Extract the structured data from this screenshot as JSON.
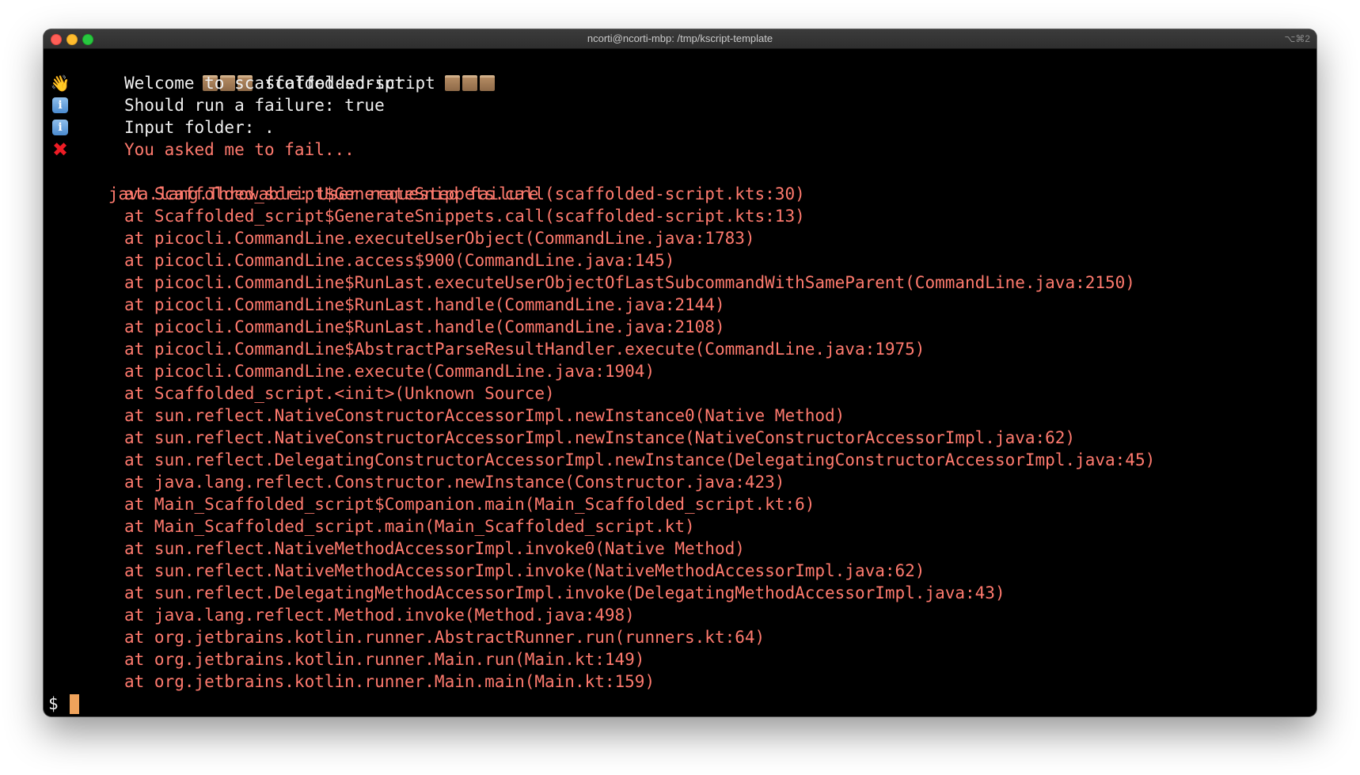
{
  "window": {
    "title": "ncorti@ncorti-mbp: /tmp/kscript-template",
    "shortcut": "⌥⌘2"
  },
  "header": {
    "text": "scaffolded-script"
  },
  "messages": [
    {
      "icon": "waving-hand-icon",
      "glyph": "👋",
      "text": "Welcome to scaffolded-script",
      "color": "white"
    },
    {
      "icon": "info-icon",
      "glyph": "i",
      "text": "Should run a failure: true",
      "color": "white"
    },
    {
      "icon": "info-icon",
      "glyph": "i",
      "text": "Input folder: .",
      "color": "white"
    },
    {
      "icon": "cross-mark-icon",
      "glyph": "✖",
      "text": "You asked me to fail...",
      "color": "red"
    }
  ],
  "exception": "java.lang.Throwable: User requested failure",
  "stack": [
    "at Scaffolded_script$GenerateSnippets.call(scaffolded-script.kts:30)",
    "at Scaffolded_script$GenerateSnippets.call(scaffolded-script.kts:13)",
    "at picocli.CommandLine.executeUserObject(CommandLine.java:1783)",
    "at picocli.CommandLine.access$900(CommandLine.java:145)",
    "at picocli.CommandLine$RunLast.executeUserObjectOfLastSubcommandWithSameParent(CommandLine.java:2150)",
    "at picocli.CommandLine$RunLast.handle(CommandLine.java:2144)",
    "at picocli.CommandLine$RunLast.handle(CommandLine.java:2108)",
    "at picocli.CommandLine$AbstractParseResultHandler.execute(CommandLine.java:1975)",
    "at picocli.CommandLine.execute(CommandLine.java:1904)",
    "at Scaffolded_script.<init>(Unknown Source)",
    "at sun.reflect.NativeConstructorAccessorImpl.newInstance0(Native Method)",
    "at sun.reflect.NativeConstructorAccessorImpl.newInstance(NativeConstructorAccessorImpl.java:62)",
    "at sun.reflect.DelegatingConstructorAccessorImpl.newInstance(DelegatingConstructorAccessorImpl.java:45)",
    "at java.lang.reflect.Constructor.newInstance(Constructor.java:423)",
    "at Main_Scaffolded_script$Companion.main(Main_Scaffolded_script.kt:6)",
    "at Main_Scaffolded_script.main(Main_Scaffolded_script.kt)",
    "at sun.reflect.NativeMethodAccessorImpl.invoke0(Native Method)",
    "at sun.reflect.NativeMethodAccessorImpl.invoke(NativeMethodAccessorImpl.java:62)",
    "at sun.reflect.DelegatingMethodAccessorImpl.invoke(DelegatingMethodAccessorImpl.java:43)",
    "at java.lang.reflect.Method.invoke(Method.java:498)",
    "at org.jetbrains.kotlin.runner.AbstractRunner.run(runners.kt:64)",
    "at org.jetbrains.kotlin.runner.Main.run(Main.kt:149)",
    "at org.jetbrains.kotlin.runner.Main.main(Main.kt:159)"
  ],
  "prompt": "$",
  "colors": {
    "background": "#000000",
    "text": "#f0f0f0",
    "error": "#ff7a6e",
    "cursor": "#f0a35b"
  }
}
